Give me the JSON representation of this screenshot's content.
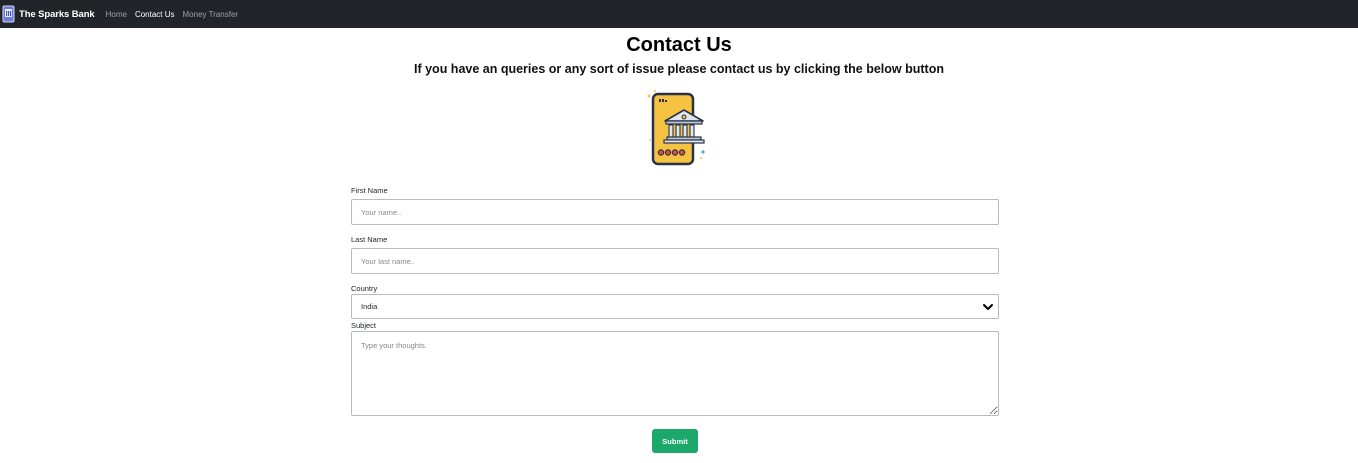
{
  "navbar": {
    "brand": "The Sparks Bank",
    "links": [
      {
        "label": "Home",
        "active": false
      },
      {
        "label": "Contact Us",
        "active": true
      },
      {
        "label": "Money Transfer",
        "active": false
      }
    ]
  },
  "page": {
    "title": "Contact Us",
    "subtitle": "If you have an queries or any sort of issue please contact us by clicking the below button"
  },
  "hero": {
    "icon": "mobile-bank-icon"
  },
  "form": {
    "first_name": {
      "label": "First Name",
      "placeholder": "Your name.."
    },
    "last_name": {
      "label": "Last Name",
      "placeholder": "Your last name.."
    },
    "country": {
      "label": "Country",
      "value": "India"
    },
    "subject": {
      "label": "Subject",
      "placeholder": "Type your thoughts."
    },
    "submit_label": "Submit"
  },
  "colors": {
    "navbar_bg": "#212529",
    "submit_bg": "#1ba86a",
    "phone_yellow": "#f5c242",
    "phone_outline": "#2a3346"
  }
}
